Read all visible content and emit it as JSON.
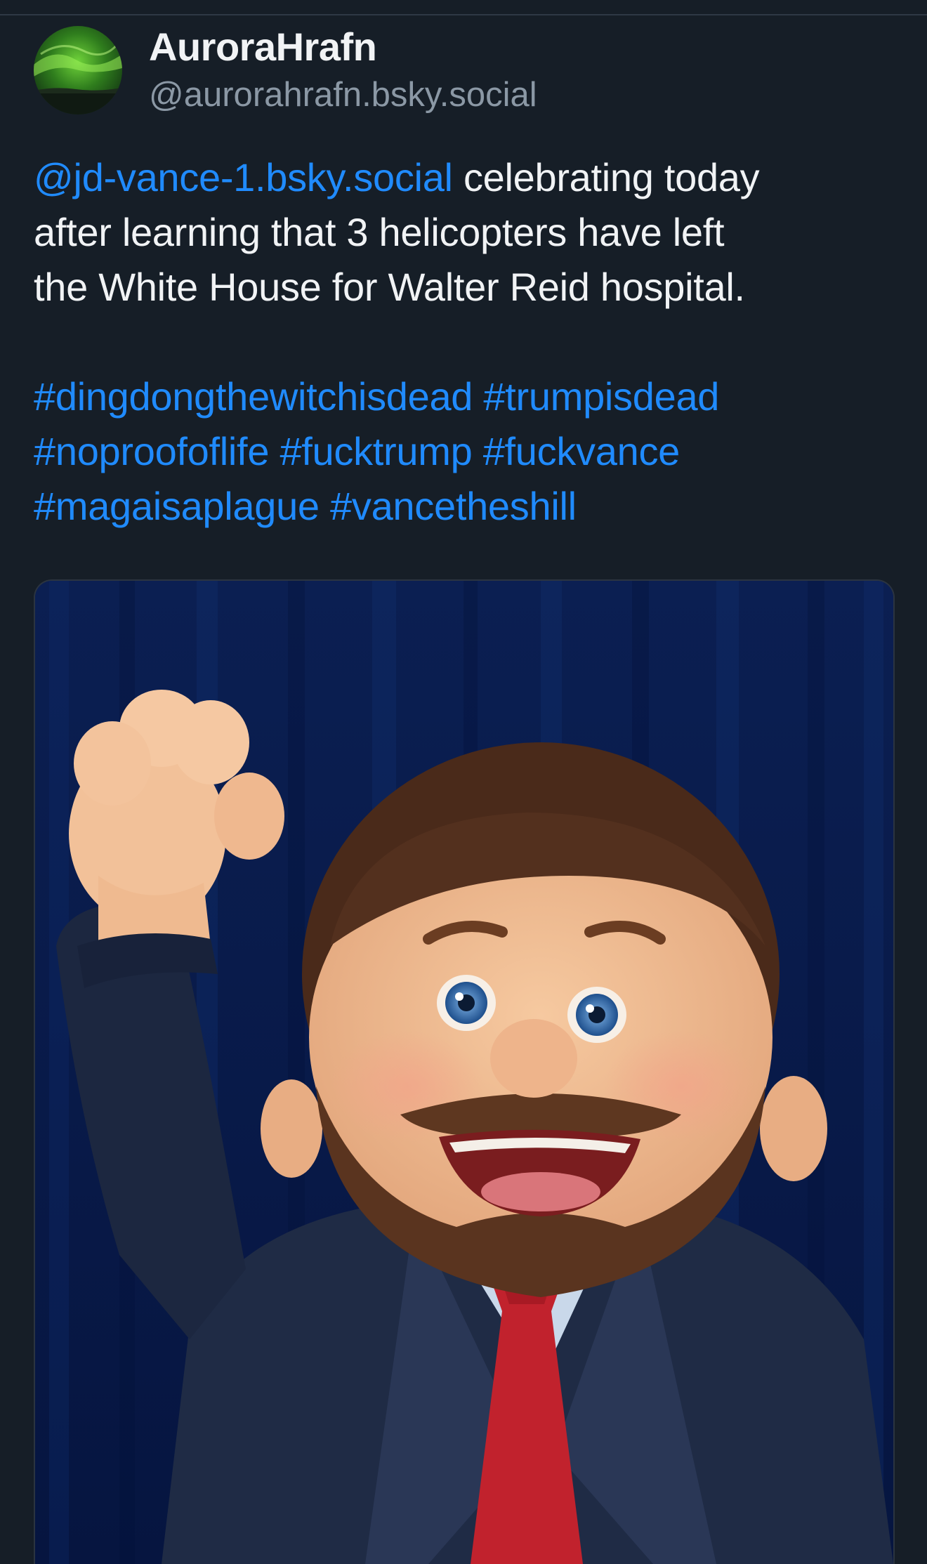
{
  "post": {
    "author": {
      "display_name": "AuroraHrafn",
      "handle": "@aurorahrafn.bsky.social",
      "avatar_icon": "aurora-avatar-icon"
    },
    "text": {
      "mention": "@jd-vance-1.bsky.social",
      "line1_rest": " celebrating today",
      "line2": "after learning that 3 helicopters have left",
      "line3": "the White House for Walter Reid hospital.",
      "hashtags": [
        "#dingdongthewitchisdead",
        "#trumpisdead",
        "#noproofoflife",
        "#fucktrump",
        "#fuckvance",
        "#magaisaplague",
        "#vancetheshill"
      ]
    },
    "media": {
      "type": "image",
      "subject": "cabbage-patch-style-doll-fist-raised"
    }
  },
  "colors": {
    "background": "#161e27",
    "link": "#208bfe",
    "text": "#f1f3f5",
    "secondary_text": "#8b98a5"
  }
}
